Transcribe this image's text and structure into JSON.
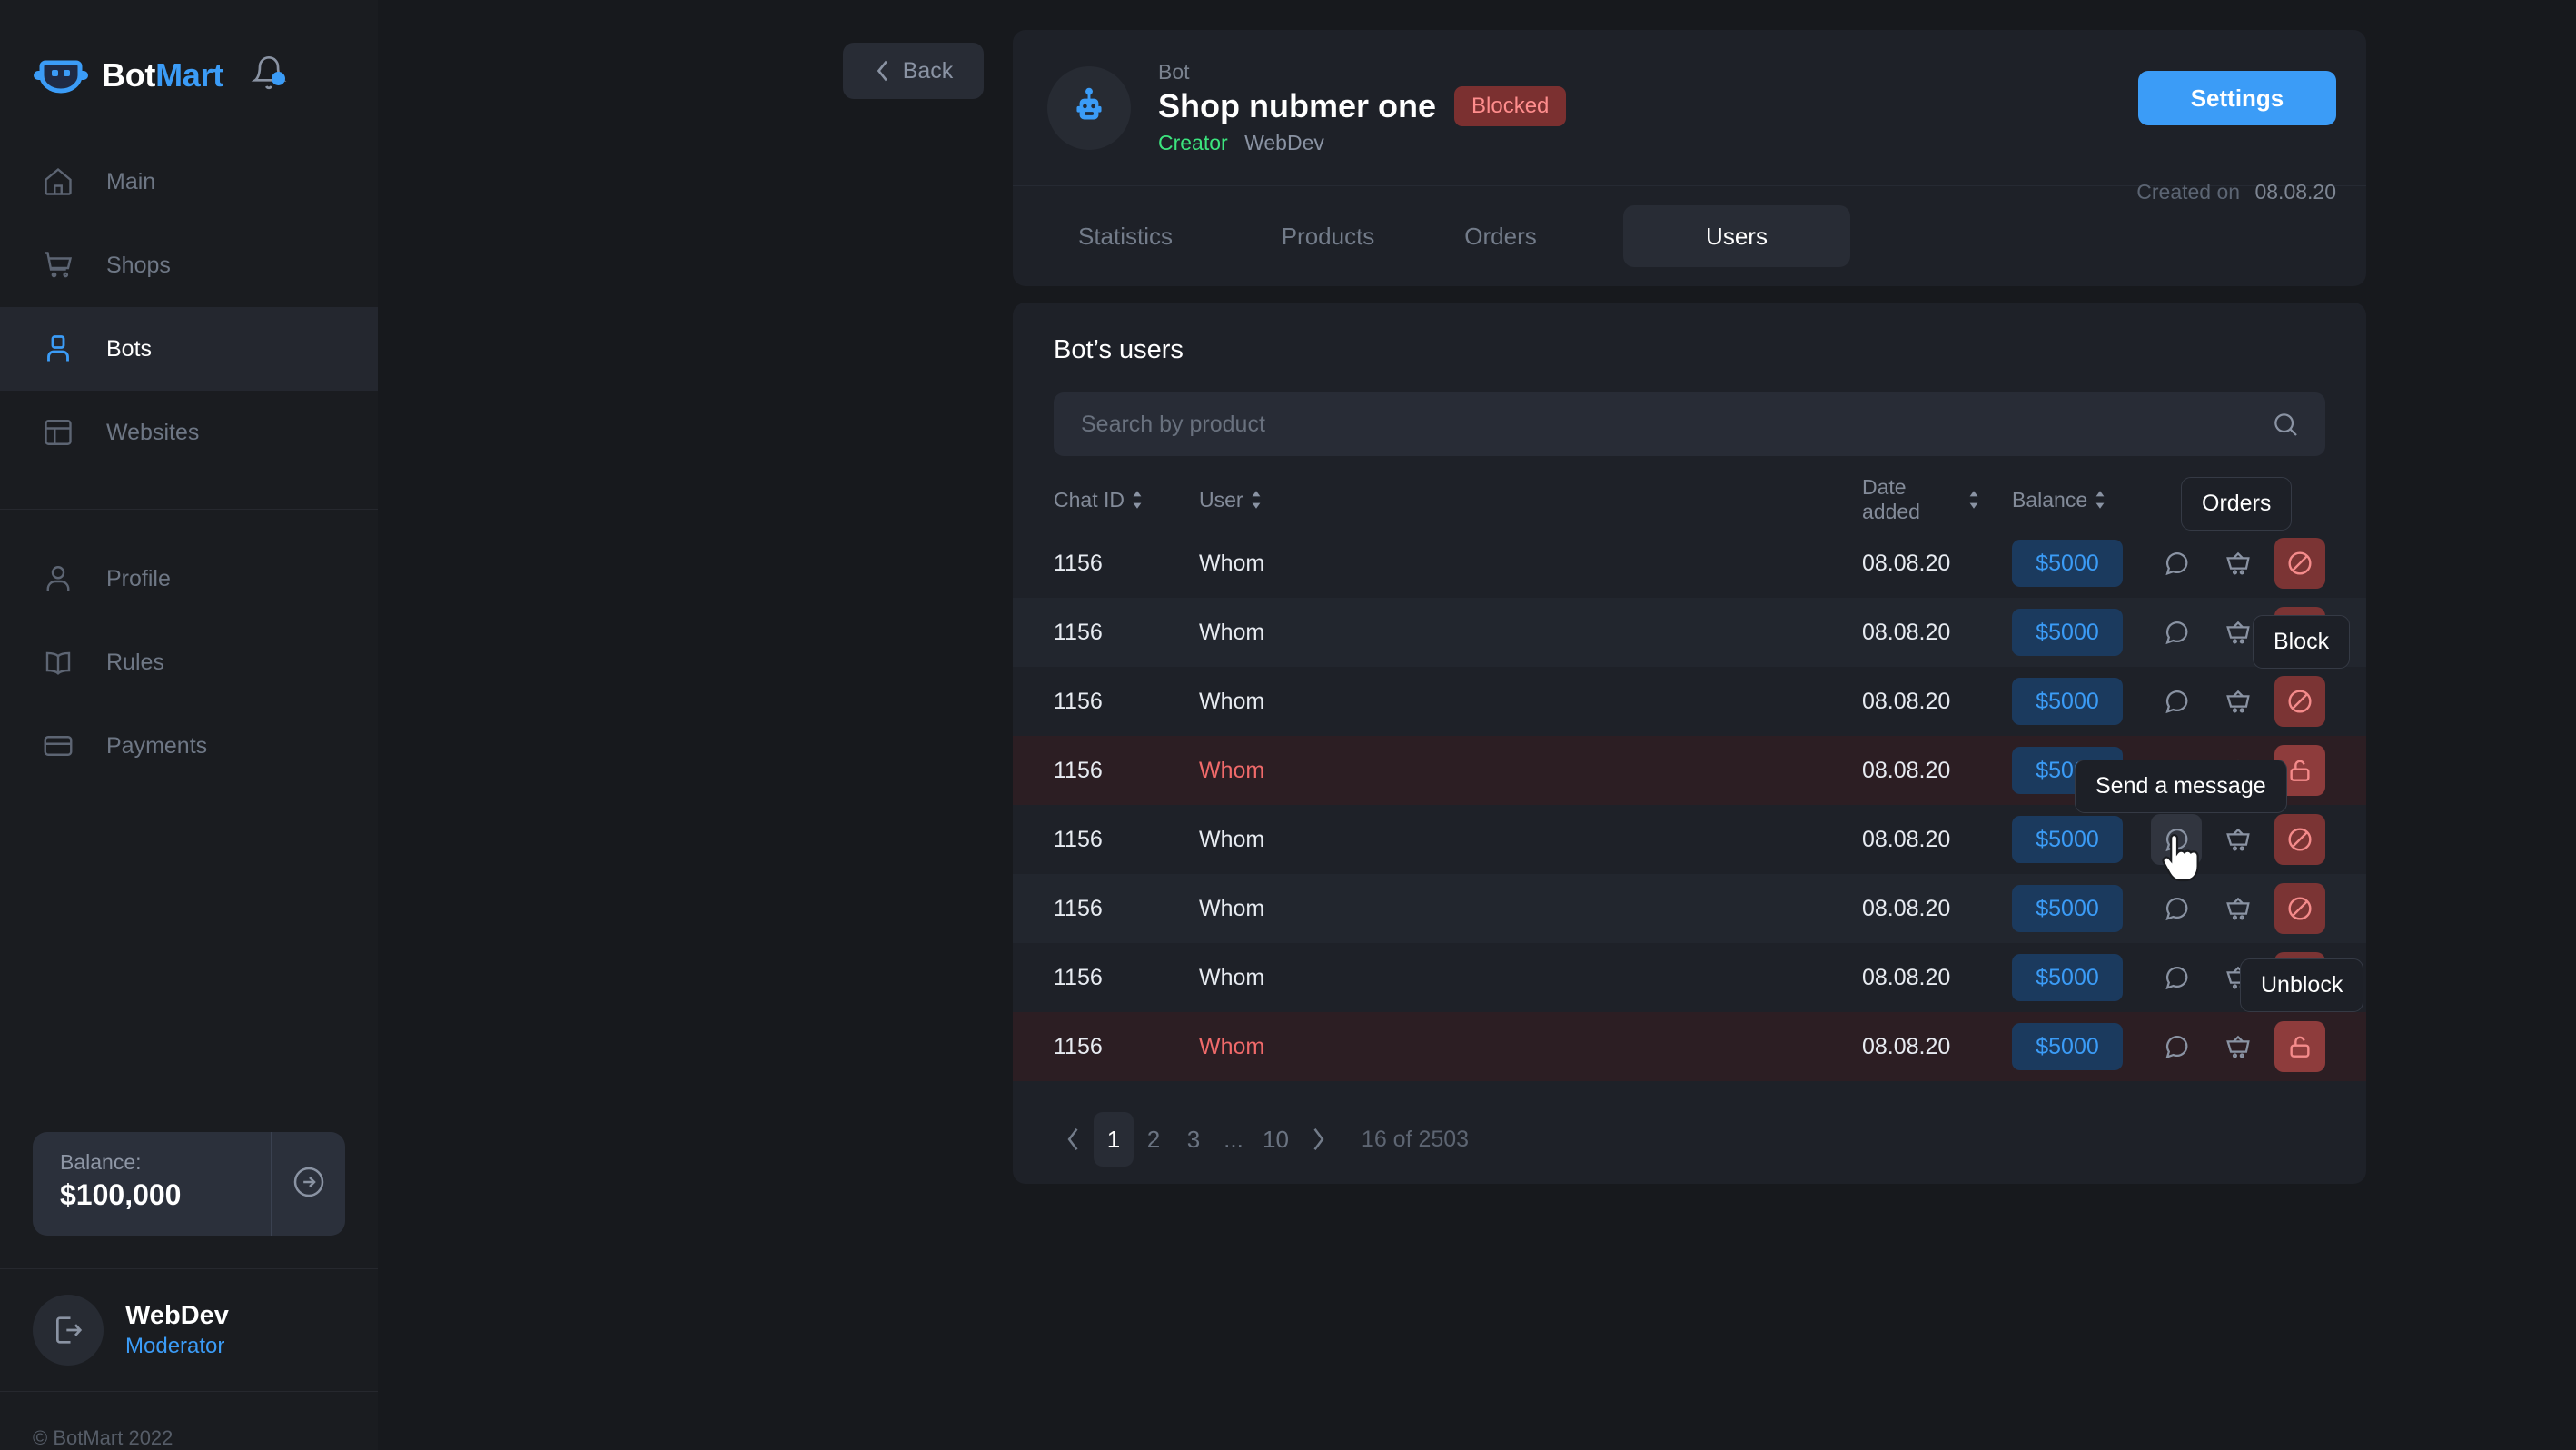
{
  "brand": {
    "name_white": "Bot",
    "name_blue": "Mart"
  },
  "sidebar": {
    "nav_primary": [
      {
        "label": "Main",
        "icon": "home-icon"
      },
      {
        "label": "Shops",
        "icon": "cart-icon"
      },
      {
        "label": "Bots",
        "icon": "bot-user-icon"
      },
      {
        "label": "Websites",
        "icon": "layout-icon"
      }
    ],
    "nav_secondary": [
      {
        "label": "Profile",
        "icon": "person-icon"
      },
      {
        "label": "Rules",
        "icon": "book-icon"
      },
      {
        "label": "Payments",
        "icon": "card-icon"
      }
    ],
    "balance": {
      "label": "Balance:",
      "value": "$100,000"
    },
    "profile": {
      "name": "WebDev",
      "role": "Moderator"
    },
    "copyright": "© BotMart 2022"
  },
  "header": {
    "back_label": "Back",
    "bot_kind": "Bot",
    "bot_name": "Shop nubmer one",
    "status_badge": "Blocked",
    "creator_label": "Creator",
    "creator_name": "WebDev",
    "settings_label": "Settings",
    "created_label": "Created on",
    "created_date": "08.08.20"
  },
  "tabs": [
    {
      "label": "Statistics"
    },
    {
      "label": "Products"
    },
    {
      "label": "Orders"
    },
    {
      "label": "Users"
    }
  ],
  "users_panel": {
    "title": "Bot’s users",
    "search_placeholder": "Search by product",
    "search_value": "",
    "columns": {
      "chat_id": "Chat ID",
      "user": "User",
      "date_added": "Date added",
      "balance": "Balance"
    },
    "rows": [
      {
        "chat_id": "1156",
        "user": "Whom",
        "date": "08.08.20",
        "balance": "$5000",
        "blocked": false
      },
      {
        "chat_id": "1156",
        "user": "Whom",
        "date": "08.08.20",
        "balance": "$5000",
        "blocked": false
      },
      {
        "chat_id": "1156",
        "user": "Whom",
        "date": "08.08.20",
        "balance": "$5000",
        "blocked": false
      },
      {
        "chat_id": "1156",
        "user": "Whom",
        "date": "08.08.20",
        "balance": "$5000",
        "blocked": true
      },
      {
        "chat_id": "1156",
        "user": "Whom",
        "date": "08.08.20",
        "balance": "$5000",
        "blocked": false
      },
      {
        "chat_id": "1156",
        "user": "Whom",
        "date": "08.08.20",
        "balance": "$5000",
        "blocked": false
      },
      {
        "chat_id": "1156",
        "user": "Whom",
        "date": "08.08.20",
        "balance": "$5000",
        "blocked": false
      },
      {
        "chat_id": "1156",
        "user": "Whom",
        "date": "08.08.20",
        "balance": "$5000",
        "blocked": true
      }
    ],
    "pagination": {
      "pages": [
        "1",
        "2",
        "3",
        "...",
        "10"
      ],
      "active": "1",
      "info": "16 of 2503"
    }
  },
  "tooltips": {
    "orders": "Orders",
    "block": "Block",
    "send_message": "Send a message",
    "unblock": "Unblock"
  },
  "colors": {
    "accent": "#3b9cf7",
    "danger": "#f06a6a",
    "success": "#3ce47e",
    "bg": "#17191d",
    "panel": "#1e2128"
  }
}
